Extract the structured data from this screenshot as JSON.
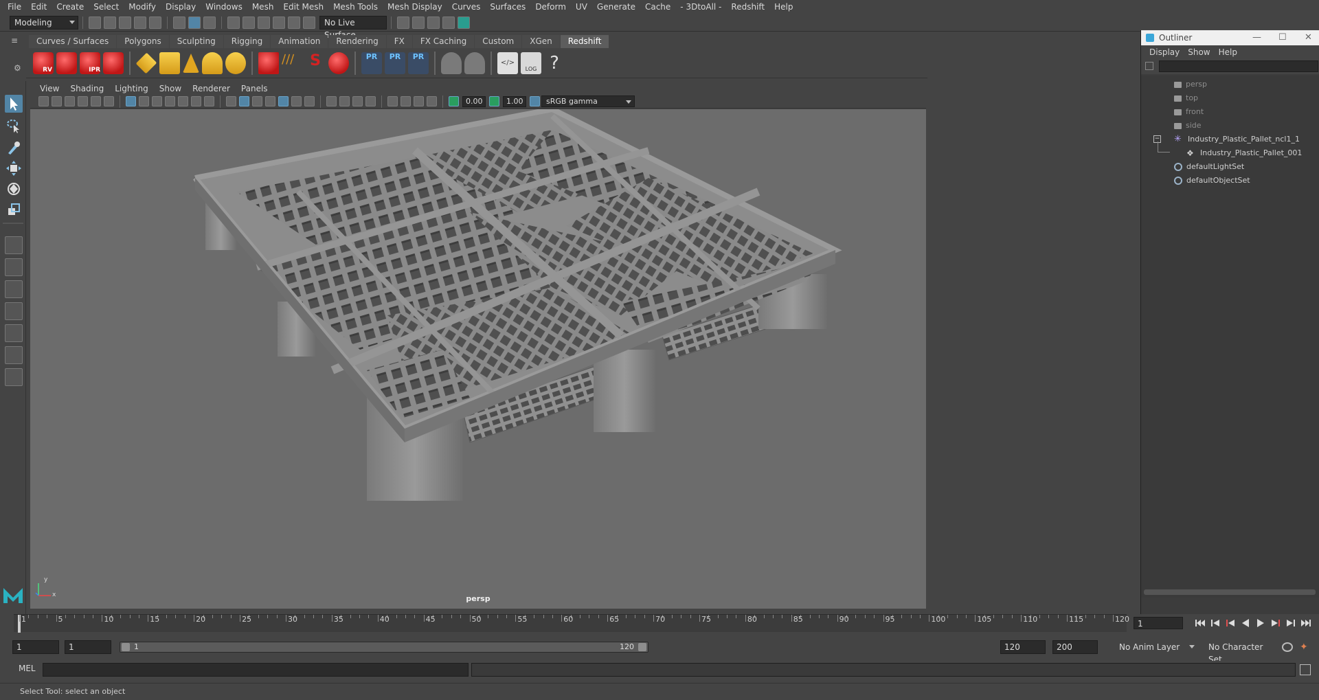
{
  "menu": [
    "File",
    "Edit",
    "Create",
    "Select",
    "Modify",
    "Display",
    "Windows",
    "Mesh",
    "Edit Mesh",
    "Mesh Tools",
    "Mesh Display",
    "Curves",
    "Surfaces",
    "Deform",
    "UV",
    "Generate",
    "Cache",
    "- 3DtoAll -",
    "Redshift",
    "Help"
  ],
  "status": {
    "mode": "Modeling",
    "live_surface": "No Live Surface"
  },
  "shelf_tabs": [
    "Curves / Surfaces",
    "Polygons",
    "Sculpting",
    "Rigging",
    "Animation",
    "Rendering",
    "FX",
    "FX Caching",
    "Custom",
    "XGen",
    "Redshift"
  ],
  "shelf_active": "Redshift",
  "shelf_icons": {
    "rv": "RV",
    "ipr": "IPR",
    "pr1": "PR",
    "pr2": "PR",
    "pr3": "PR",
    "log": "LOG",
    "help": "?"
  },
  "panel_menu": [
    "View",
    "Shading",
    "Lighting",
    "Show",
    "Renderer",
    "Panels"
  ],
  "panel_toolbar": {
    "exposure": "0.00",
    "gamma": "1.00",
    "color_space": "sRGB gamma"
  },
  "viewport": {
    "camera_label": "persp",
    "axis_x": "x",
    "axis_y": "y"
  },
  "outliner": {
    "title": "Outliner",
    "menu": [
      "Display",
      "Show",
      "Help"
    ],
    "items": [
      {
        "label": "persp",
        "type": "camera"
      },
      {
        "label": "top",
        "type": "camera"
      },
      {
        "label": "front",
        "type": "camera"
      },
      {
        "label": "side",
        "type": "camera"
      },
      {
        "label": "Industry_Plastic_Pallet_ncl1_1",
        "type": "group"
      },
      {
        "label": "Industry_Plastic_Pallet_001",
        "type": "mesh"
      },
      {
        "label": "defaultLightSet",
        "type": "set"
      },
      {
        "label": "defaultObjectSet",
        "type": "set"
      }
    ]
  },
  "timeline": {
    "ticks": [
      "1",
      "5",
      "10",
      "15",
      "20",
      "25",
      "30",
      "35",
      "40",
      "45",
      "50",
      "55",
      "60",
      "65",
      "70",
      "75",
      "80",
      "85",
      "90",
      "95",
      "100",
      "105",
      "110",
      "115",
      "120"
    ],
    "current_frame": "1"
  },
  "range": {
    "start": "1",
    "playback_start": "1",
    "slider_start": "1",
    "slider_end": "120",
    "playback_end": "120",
    "end": "200",
    "anim_layer": "No Anim Layer",
    "character_set": "No Character Set"
  },
  "command": {
    "label": "MEL"
  },
  "help_line": "Select Tool: select an object",
  "colors": {
    "ui_bg": "#444444",
    "viewport_bg": "#6c6c6c",
    "accent": "#5285a6",
    "redshift_red": "#d42222"
  }
}
